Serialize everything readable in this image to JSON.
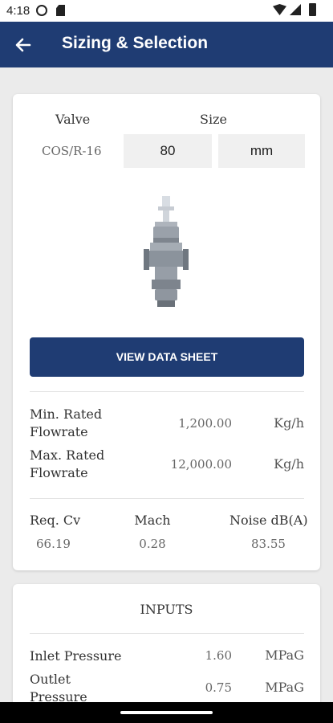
{
  "status_bar": {
    "time": "4:18"
  },
  "app_bar": {
    "title": "Sizing & Selection",
    "back_icon": "arrow-left-icon"
  },
  "selection": {
    "valve_label": "Valve",
    "size_label": "Size",
    "valve_value": "COS/R-16",
    "size_value": "80",
    "size_unit": "mm"
  },
  "image": {
    "icon": "valve-image"
  },
  "datasheet_button": "VIEW DATA SHEET",
  "flowrates": [
    {
      "label": "Min. Rated Flowrate",
      "value": "1,200.00",
      "unit": "Kg/h"
    },
    {
      "label": "Max. Rated Flowrate",
      "value": "12,000.00",
      "unit": "Kg/h"
    }
  ],
  "results": {
    "headers": [
      "Req. Cv",
      "Mach",
      "Noise dB(A)"
    ],
    "values": [
      "66.19",
      "0.28",
      "83.55"
    ]
  },
  "inputs": {
    "title": "INPUTS",
    "rows": [
      {
        "label": "Inlet Pressure",
        "value": "1.60",
        "unit": "MPaG"
      },
      {
        "label": "Outlet Pressure",
        "value": "0.75",
        "unit": "MPaG"
      }
    ]
  },
  "colors": {
    "primary": "#1f3c73",
    "background": "#ebebeb",
    "card": "#ffffff"
  }
}
